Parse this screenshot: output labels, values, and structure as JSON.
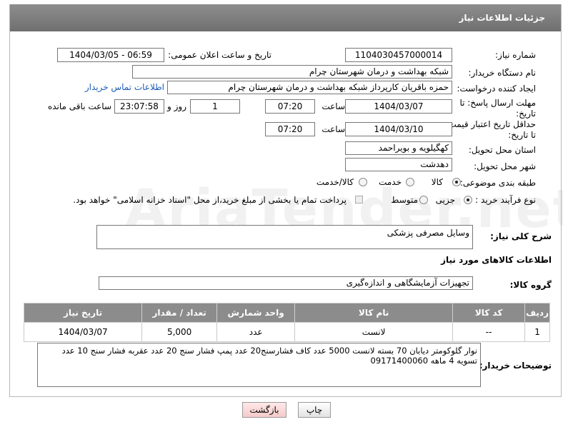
{
  "header": {
    "title": "جزئیات اطلاعات نیاز"
  },
  "fields": {
    "need_number": {
      "label": "شماره نیاز:",
      "value": "1104030457000014"
    },
    "announce_datetime": {
      "label": "تاریخ و ساعت اعلان عمومی:",
      "value": "1404/03/05 - 06:59"
    },
    "buyer_org": {
      "label": "نام دستگاه خریدار:",
      "value": "شبکه بهداشت و درمان شهرستان چرام"
    },
    "requester": {
      "label": "ایجاد کننده درخواست:",
      "value": "حمزه باقریان کارپرداز شبکه بهداشت و درمان شهرستان چرام",
      "contact_link": "اطلاعات تماس خریدار"
    },
    "reply_deadline": {
      "label_line1": "مهلت ارسال پاسخ: تا",
      "label_line2": "تاریخ:",
      "date": "1404/03/07",
      "time_label": "ساعت",
      "time": "07:20",
      "days": "1",
      "days_label": "روز و",
      "remaining": "23:07:58",
      "remaining_label": "ساعت باقی مانده"
    },
    "price_validity": {
      "label_line1": "حداقل تاریخ اعتبار قیمت:",
      "label_line2": "تا تاریخ:",
      "date": "1404/03/10",
      "time_label": "ساعت",
      "time": "07:20"
    },
    "delivery_province": {
      "label": "استان محل تحویل:",
      "value": "کهگیلویه و بویراحمد"
    },
    "delivery_city": {
      "label": "شهر محل تحویل:",
      "value": "دهدشت"
    },
    "category": {
      "label": "طبقه بندی موضوعی:",
      "options": [
        "کالا",
        "خدمت",
        "کالا/خدمت"
      ],
      "selected": "کالا"
    },
    "purchase_process": {
      "label": "نوع فرآیند خرید :",
      "options": [
        "جزیی",
        "متوسط"
      ],
      "selected": "جزیی",
      "note": "پرداخت تمام یا بخشی از مبلغ خرید،از محل \"اسناد خزانه اسلامی\" خواهد بود."
    }
  },
  "description": {
    "label": "شرح کلی نیاز:",
    "value": "وسایل مصرفی پزشکی"
  },
  "goods_section": {
    "title": "اطلاعات کالاهای مورد نیاز",
    "group_label": "گروه کالا:",
    "group_value": "تجهیزات آزمایشگاهی و اندازه‌گیری"
  },
  "table": {
    "headers": [
      "ردیف",
      "کد کالا",
      "نام کالا",
      "واحد شمارش",
      "تعداد / مقدار",
      "تاریخ نیاز"
    ],
    "rows": [
      {
        "row": "1",
        "code": "--",
        "name": "لانست",
        "unit": "عدد",
        "qty": "5,000",
        "date": "1404/03/07"
      }
    ]
  },
  "buyer_notes": {
    "label": "توضیحات خریدار:",
    "value": "نوار گلوکومتر دیابان 70 بسته لانست 5000 عدد کاف فشارسنج20 عدد پمپ فشار سنج 20 عدد عقربه فشار سنج 10 عدد تسویه 4 ماهه 09171400060"
  },
  "buttons": {
    "print": "چاپ",
    "back": "بازگشت"
  },
  "watermark": "AriaTender.net",
  "colors": {
    "titlebar": "#7f7f7f",
    "table_header": "#8c8c8c",
    "link": "#1c5bb8",
    "back_button": "#f7d3d3"
  }
}
